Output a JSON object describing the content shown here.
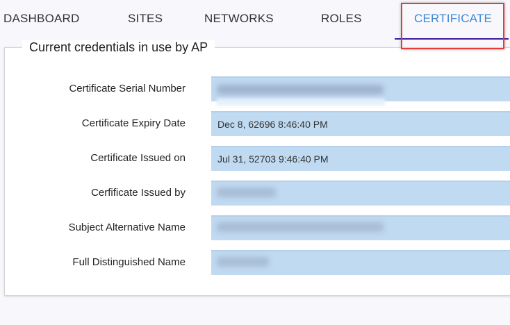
{
  "tabs": [
    {
      "label": "DASHBOARD",
      "active": false
    },
    {
      "label": "SITES",
      "active": false
    },
    {
      "label": "NETWORKS",
      "active": false
    },
    {
      "label": "ROLES",
      "active": false
    },
    {
      "label": "CERTIFICATE",
      "active": true
    }
  ],
  "colors": {
    "active_tab": "#3d86d6",
    "tab_underline": "#3d1a9e",
    "field_bg": "#c0daf1",
    "highlight": "#e8383a"
  },
  "card": {
    "title": "Current credentials in use by AP",
    "rows": [
      {
        "label": "Certificate Serial Number",
        "redacted": true
      },
      {
        "label": "Certificate Expiry Date",
        "value": "Dec 8, 62696 8:46:40 PM"
      },
      {
        "label": "Certificate Issued on",
        "value": "Jul 31, 52703 9:46:40 PM"
      },
      {
        "label": "Cerfificate Issued by",
        "redacted": true
      },
      {
        "label": "Subject Alternative Name",
        "redacted": true
      },
      {
        "label": "Full Distinguished Name",
        "redacted": true
      }
    ]
  }
}
